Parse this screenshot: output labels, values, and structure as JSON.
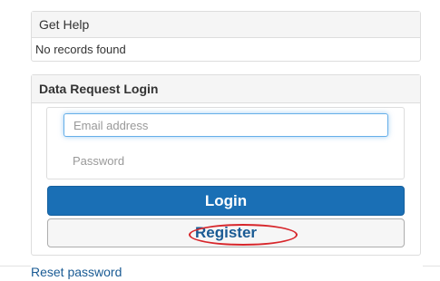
{
  "help_panel": {
    "title": "Get Help",
    "empty_text": "No records found"
  },
  "login_panel": {
    "title": "Data Request Login",
    "email": {
      "placeholder": "Email address",
      "value": ""
    },
    "password": {
      "placeholder": "Password",
      "value": ""
    },
    "login_label": "Login",
    "register_label": "Register"
  },
  "reset_link": "Reset password",
  "colors": {
    "primary": "#1a6fb5",
    "link": "#1a5b94",
    "highlight": "#d7262b"
  }
}
